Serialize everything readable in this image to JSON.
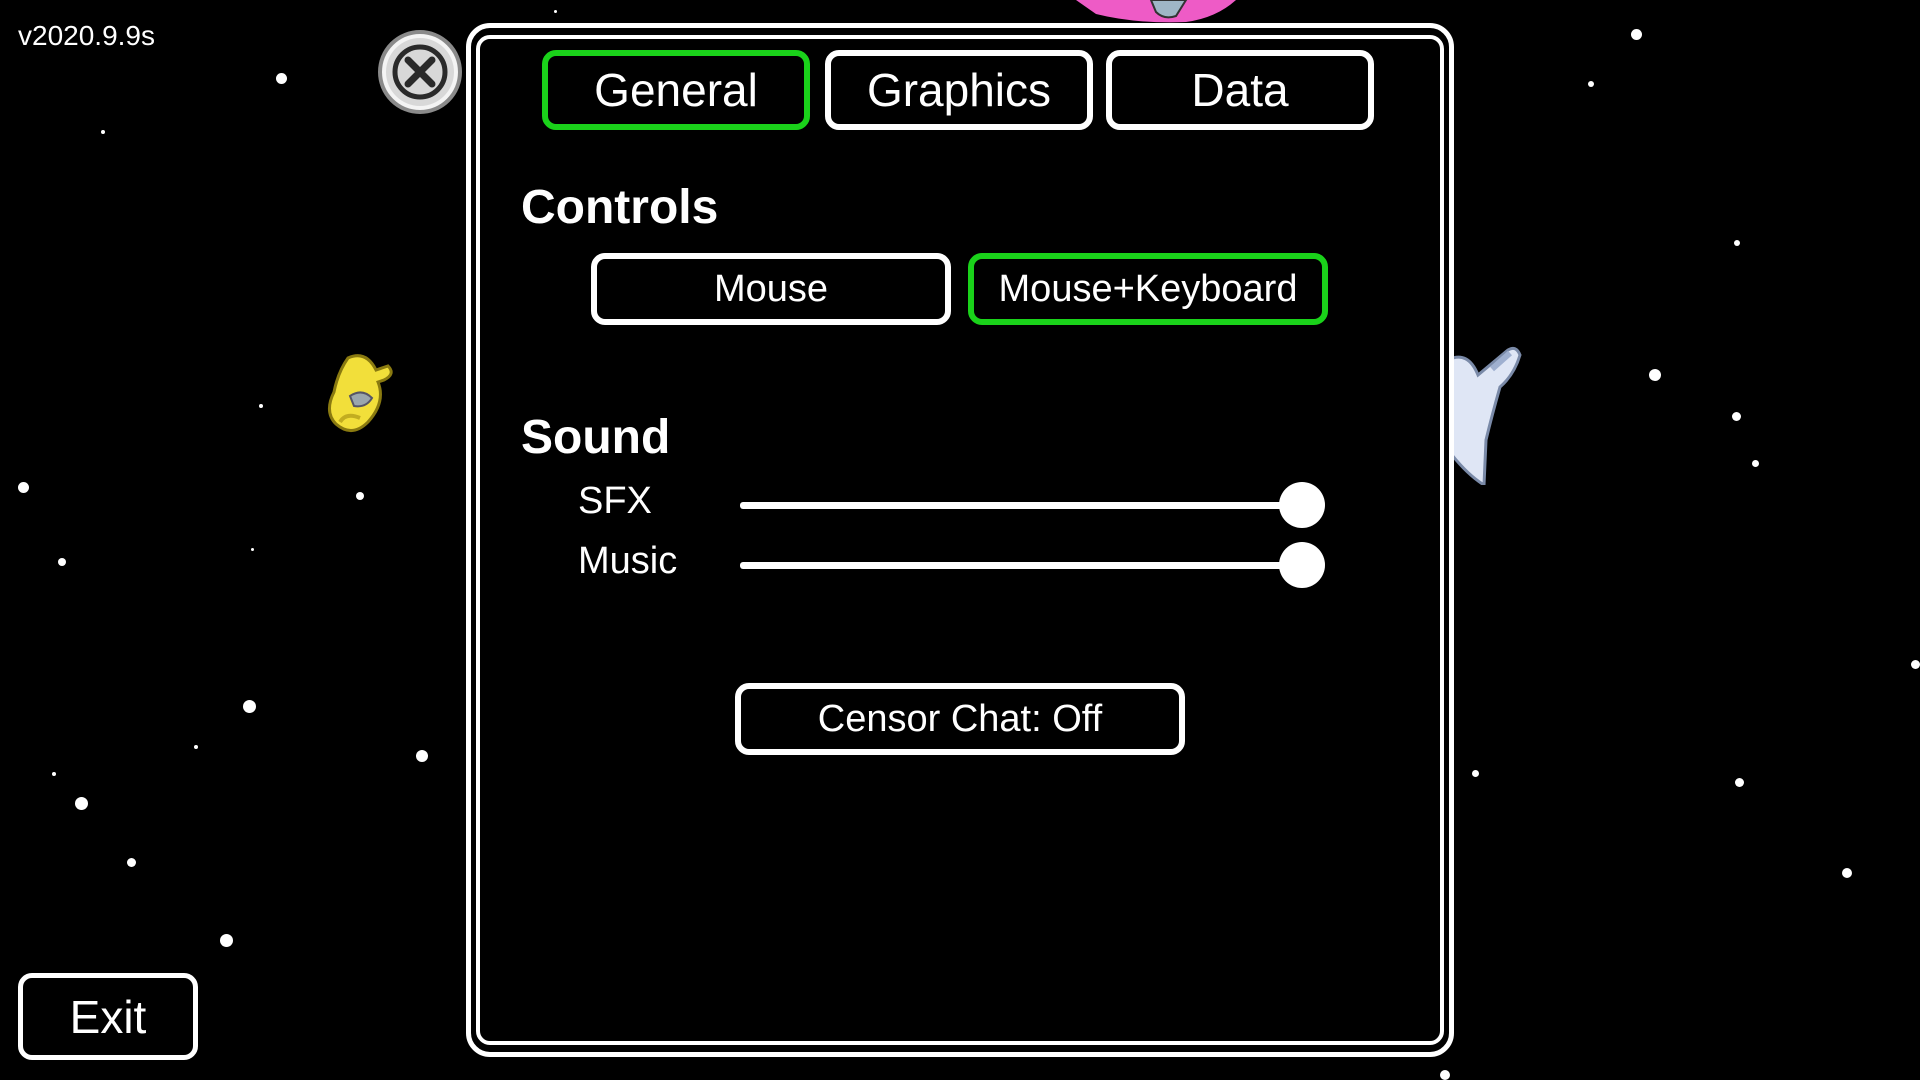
{
  "version": "v2020.9.9s",
  "exit_label": "Exit",
  "close_icon": "close-icon",
  "tabs": [
    {
      "label": "General",
      "active": true
    },
    {
      "label": "Graphics",
      "active": false
    },
    {
      "label": "Data",
      "active": false
    }
  ],
  "controls": {
    "title": "Controls",
    "options": [
      {
        "label": "Mouse",
        "selected": false
      },
      {
        "label": "Mouse+Keyboard",
        "selected": true
      }
    ]
  },
  "sound": {
    "title": "Sound",
    "sfx": {
      "label": "SFX",
      "value": 1.0
    },
    "music": {
      "label": "Music",
      "value": 1.0
    }
  },
  "censor_chat_label": "Censor Chat: Off",
  "colors": {
    "accent_selected": "#1ad21a",
    "background": "#000000",
    "foreground": "#ffffff"
  }
}
